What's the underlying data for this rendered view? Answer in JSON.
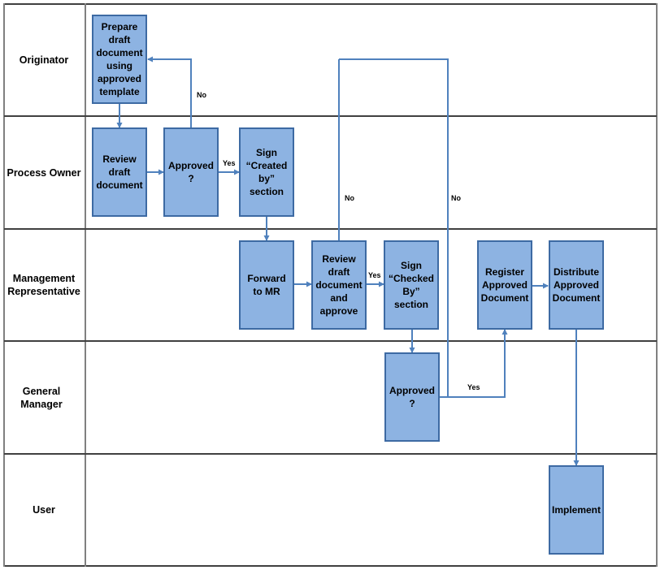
{
  "diagram": {
    "type": "swimlane-flowchart",
    "colors": {
      "box_fill": "#8db3e2",
      "box_border": "#3d6aa3",
      "connector": "#4f81bd",
      "lane_border": "#404040"
    },
    "lanes": [
      {
        "id": "originator",
        "label": "Originator"
      },
      {
        "id": "process_owner",
        "label": "Process Owner"
      },
      {
        "id": "mr",
        "label": "Management Representative"
      },
      {
        "id": "gm",
        "label": "General Manager"
      },
      {
        "id": "user",
        "label": "User"
      }
    ],
    "steps": {
      "prepare": "Prepare draft document using approved template",
      "review_po": "Review draft document",
      "approved_po": "Approved ?",
      "sign_created": "Sign “Created by” section",
      "forward_mr": "Forward to MR",
      "review_mr": "Review draft document and approve",
      "sign_checked": "Sign “Checked By” section",
      "register": "Register Approved Document",
      "distribute": "Distribute Approved Document",
      "approved_gm": "Approved ?",
      "implement": "Implement"
    },
    "edge_labels": {
      "po_no": "No",
      "po_yes": "Yes",
      "mr_no": "No",
      "mr_yes": "Yes",
      "gm_no": "No",
      "gm_yes": "Yes"
    }
  }
}
